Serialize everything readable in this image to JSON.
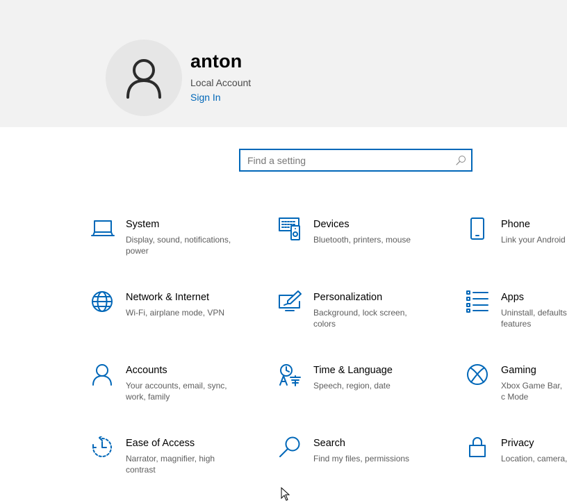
{
  "user": {
    "name": "anton",
    "account_type": "Local Account",
    "sign_in_label": "Sign In"
  },
  "search": {
    "placeholder": "Find a setting",
    "value": ""
  },
  "colors": {
    "accent": "#0067b8",
    "header_bg": "#f2f2f2"
  },
  "settings": [
    {
      "title": "System",
      "desc": "Display, sound, notifications, power",
      "icon": "laptop-icon"
    },
    {
      "title": "Devices",
      "desc": "Bluetooth, printers, mouse",
      "icon": "devices-icon"
    },
    {
      "title": "Phone",
      "desc": "Link your Android",
      "icon": "phone-icon"
    },
    {
      "title": "Network & Internet",
      "desc": "Wi-Fi, airplane mode, VPN",
      "icon": "globe-icon"
    },
    {
      "title": "Personalization",
      "desc": "Background, lock screen, colors",
      "icon": "paint-icon"
    },
    {
      "title": "Apps",
      "desc": "Uninstall, defaults, features",
      "icon": "apps-list-icon"
    },
    {
      "title": "Accounts",
      "desc": "Your accounts, email, sync, work, family",
      "icon": "person-icon"
    },
    {
      "title": "Time & Language",
      "desc": "Speech, region, date",
      "icon": "time-language-icon"
    },
    {
      "title": "Gaming",
      "desc": "Xbox Game Bar, c Mode",
      "icon": "xbox-icon"
    },
    {
      "title": "Ease of Access",
      "desc": "Narrator, magnifier, high contrast",
      "icon": "ease-of-access-icon"
    },
    {
      "title": "Search",
      "desc": "Find my files, permissions",
      "icon": "search-icon"
    },
    {
      "title": "Privacy",
      "desc": "Location, camera,",
      "icon": "lock-icon"
    }
  ]
}
